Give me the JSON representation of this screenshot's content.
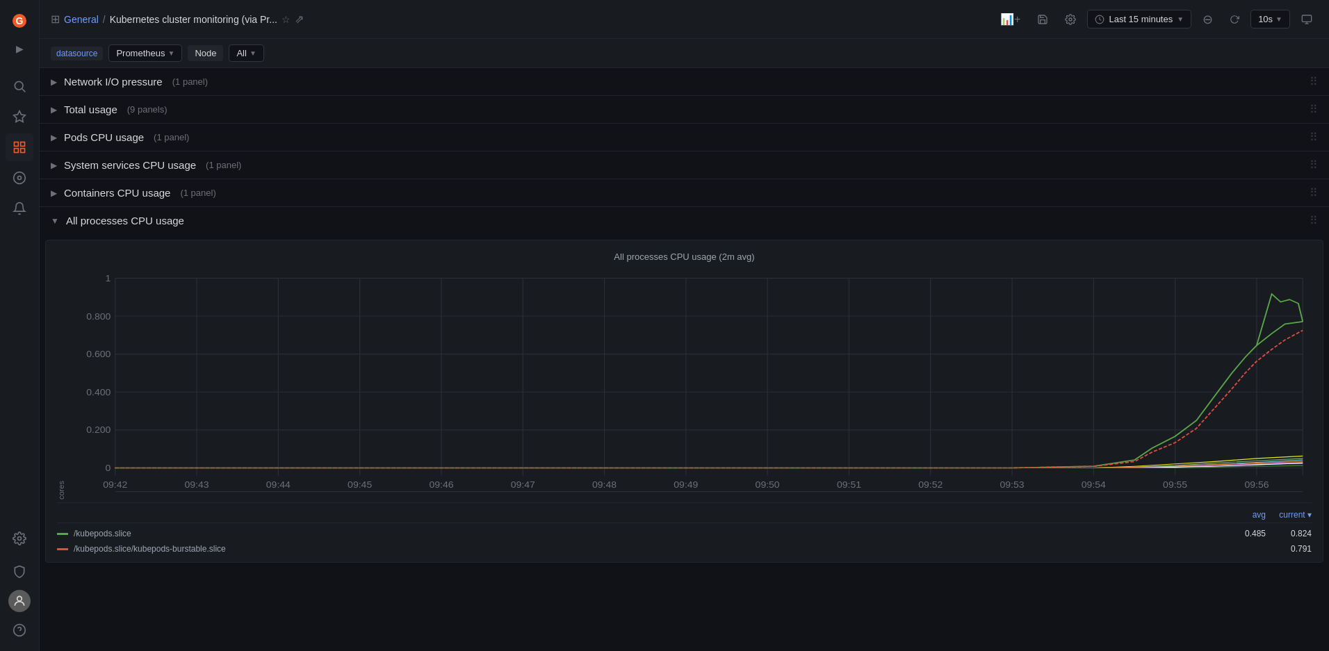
{
  "sidebar": {
    "logo_alt": "Grafana",
    "items": [
      {
        "id": "search",
        "icon": "🔍",
        "label": "Search"
      },
      {
        "id": "starred",
        "icon": "★",
        "label": "Starred"
      },
      {
        "id": "dashboards",
        "icon": "▦",
        "label": "Dashboards",
        "active": true
      },
      {
        "id": "explore",
        "icon": "◎",
        "label": "Explore"
      },
      {
        "id": "alerting",
        "icon": "🔔",
        "label": "Alerting"
      }
    ],
    "bottom_items": [
      {
        "id": "settings",
        "icon": "⚙",
        "label": "Settings"
      },
      {
        "id": "shield",
        "icon": "🛡",
        "label": "Shield"
      },
      {
        "id": "user",
        "icon": "👤",
        "label": "User"
      },
      {
        "id": "help",
        "icon": "?",
        "label": "Help"
      }
    ]
  },
  "topbar": {
    "nav_icon": "⊞",
    "breadcrumb": "General",
    "separator": "/",
    "title": "Kubernetes cluster monitoring (via Pr...",
    "star_icon": "☆",
    "share_icon": "⇗",
    "add_panel_btn": "Add panel",
    "save_btn": "Save",
    "settings_btn": "Settings",
    "time_range": "Last 15 minutes",
    "zoom_out": "⊖",
    "refresh_interval": "10s",
    "tv_mode": "⬜"
  },
  "filterbar": {
    "datasource_label": "datasource",
    "datasource_value": "Prometheus",
    "node_label": "Node",
    "node_value": "All"
  },
  "sections": [
    {
      "id": "network-io",
      "title": "Network I/O pressure",
      "count": "1 panel",
      "collapsed": true
    },
    {
      "id": "total-usage",
      "title": "Total usage",
      "count": "9 panels",
      "collapsed": true
    },
    {
      "id": "pods-cpu",
      "title": "Pods CPU usage",
      "count": "1 panel",
      "collapsed": true
    },
    {
      "id": "system-services-cpu",
      "title": "System services CPU usage",
      "count": "1 panel",
      "collapsed": true
    },
    {
      "id": "containers-cpu",
      "title": "Containers CPU usage",
      "count": "1 panel",
      "collapsed": true
    }
  ],
  "expanded_section": {
    "title": "All processes CPU usage",
    "chart_title": "All processes CPU usage (2m avg)",
    "y_axis_label": "cores",
    "y_axis_values": [
      "1",
      "0.800",
      "0.600",
      "0.400",
      "0.200",
      "0"
    ],
    "x_axis_values": [
      "09:42",
      "09:43",
      "09:44",
      "09:45",
      "09:46",
      "09:47",
      "09:48",
      "09:49",
      "09:50",
      "09:51",
      "09:52",
      "09:53",
      "09:54",
      "09:55",
      "09:56"
    ],
    "legend_header": {
      "avg_label": "avg",
      "current_label": "current ▾"
    },
    "legend_items": [
      {
        "color": "#5aa64b",
        "dash": false,
        "label": "/kubepods.slice",
        "avg": "0.485",
        "current": "0.824"
      },
      {
        "color": "#e24d42",
        "dash": true,
        "label": "/kubepods.slice/kubepods-burstable.slice",
        "avg": "",
        "current": "0.791"
      }
    ]
  }
}
